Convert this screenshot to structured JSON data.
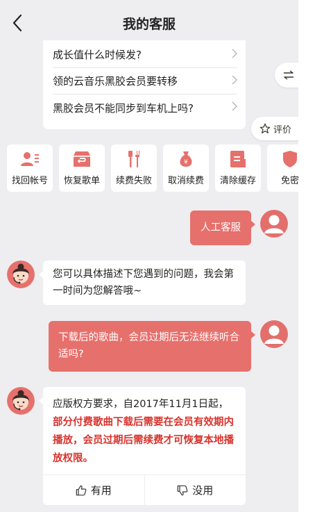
{
  "header": {
    "title": "我的客服"
  },
  "faq": [
    {
      "text": "成长值什么时候发?"
    },
    {
      "text": "领的云音乐黑胶会员要转移"
    },
    {
      "text": "黑胶会员不能同步到车机上吗?"
    }
  ],
  "side": {
    "rate_label": "评价"
  },
  "quick_actions": [
    {
      "label": "找回帐号",
      "icon": "user-list-icon"
    },
    {
      "label": "恢复歌单",
      "icon": "restore-box-icon"
    },
    {
      "label": "续费失败",
      "icon": "tools-icon"
    },
    {
      "label": "取消续费",
      "icon": "money-bag-icon"
    },
    {
      "label": "清除缓存",
      "icon": "clear-doc-icon"
    },
    {
      "label": "免密",
      "icon": "shield-icon"
    }
  ],
  "messages": {
    "user1": "人工客服",
    "agent1": "您可以具体描述下您遇到的问题，我会第一时间为您解答哦~",
    "user2": "下载后的歌曲，会员过期后无法继续听合适吗?",
    "agent2_plain": "应版权方要求，自2017年11月1日起，",
    "agent2_highlight": "部分付费歌曲下载后需要在会员有效期内播放，会员过期后需续费才可恢复本地播放权限。"
  },
  "feedback": {
    "useful": "有用",
    "useless": "没用"
  },
  "colors": {
    "accent": "#e6706c",
    "highlight": "#d8332d",
    "background": "#eeeef0"
  }
}
